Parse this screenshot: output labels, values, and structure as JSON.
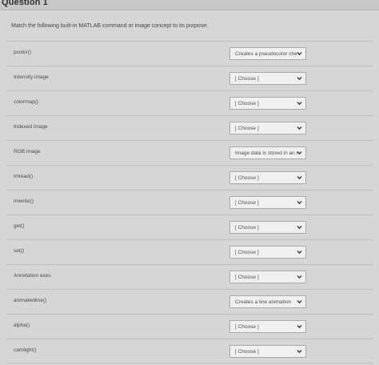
{
  "question": {
    "title": "Question 1",
    "prompt": "Match the following built-in MATLAB command or image concept to its purpose:"
  },
  "items": [
    {
      "term": "pcolor()",
      "selected": "Creates a pseudocolor checkerboard plot"
    },
    {
      "term": "Intensity image",
      "selected": "[ Choose ]"
    },
    {
      "term": "colormap()",
      "selected": "[ Choose ]"
    },
    {
      "term": "Indexed image",
      "selected": "[ Choose ]"
    },
    {
      "term": "RGB image",
      "selected": "Image data is stored in an m"
    },
    {
      "term": "imread()",
      "selected": "[ Choose ]"
    },
    {
      "term": "imwrite()",
      "selected": "[ Choose ]"
    },
    {
      "term": "get()",
      "selected": "[ Choose ]"
    },
    {
      "term": "set()",
      "selected": "[ Choose ]"
    },
    {
      "term": "Annotation axes",
      "selected": "[ Choose ]"
    },
    {
      "term": "animatedline()",
      "selected": "Creates a line animation"
    },
    {
      "term": "alpha()",
      "selected": "[ Choose ]"
    },
    {
      "term": "camlight()",
      "selected": "[ Choose ]"
    }
  ],
  "icons": {
    "dropdown": "chevron-down-icon"
  },
  "colors": {
    "background": "#d6d6d4",
    "header": "#c8c8c6",
    "select_bg": "#f0f0ee",
    "border": "#a9a9a7",
    "text": "#3e3f44"
  }
}
